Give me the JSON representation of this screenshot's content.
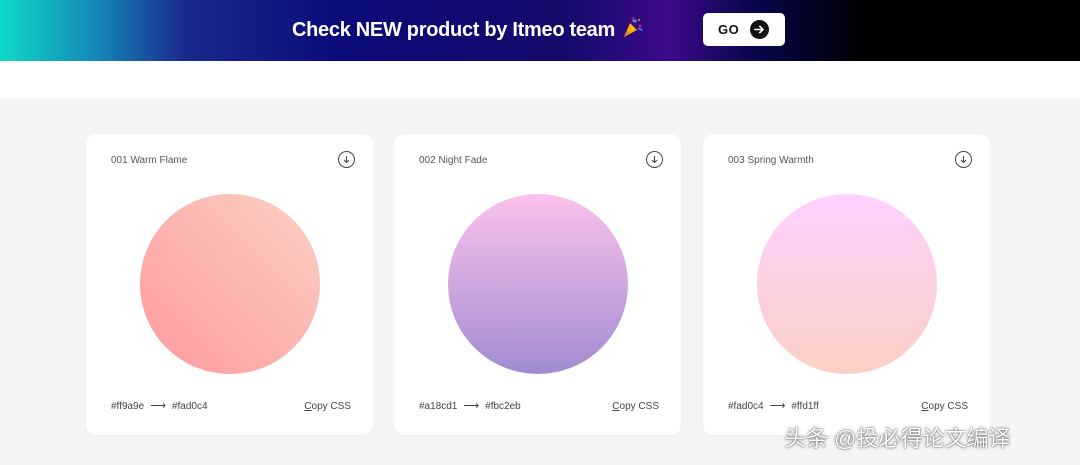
{
  "banner": {
    "text": "Check NEW product by Itmeo team",
    "icon": "party-popper-icon",
    "go_label": "GO"
  },
  "cards": [
    {
      "title": "001 Warm Flame",
      "from": "#ff9a9e",
      "to": "#fad0c4",
      "copy_label": "Copy CSS"
    },
    {
      "title": "002 Night Fade",
      "from": "#a18cd1",
      "to": "#fbc2eb",
      "copy_label": "Copy CSS"
    },
    {
      "title": "003 Spring Warmth",
      "from": "#fad0c4",
      "to": "#ffd1ff",
      "copy_label": "Copy CSS"
    }
  ],
  "watermark": "头条 @投必得论文编译",
  "colors": {
    "page_background": "#f5f5f5",
    "card_background": "#ffffff",
    "text": "#444444"
  }
}
